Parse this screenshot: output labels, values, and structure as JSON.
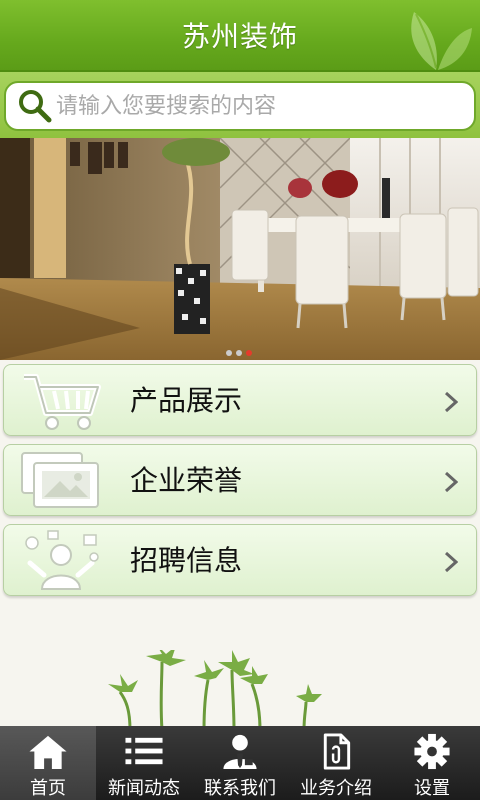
{
  "header": {
    "title": "苏州装饰"
  },
  "search": {
    "placeholder": "请输入您要搜索的内容",
    "value": ""
  },
  "banner": {
    "slide_count": 3,
    "active_slide": 3,
    "active_dot_color": "#e53b2c"
  },
  "menu": [
    {
      "label": "产品展示",
      "icon": "shopping-cart-icon"
    },
    {
      "label": "企业荣誉",
      "icon": "picture-frame-icon"
    },
    {
      "label": "招聘信息",
      "icon": "recruitment-person-icon"
    }
  ],
  "tabbar": [
    {
      "label": "首页",
      "icon": "home-icon",
      "active": true
    },
    {
      "label": "新闻动态",
      "icon": "list-icon",
      "active": false
    },
    {
      "label": "联系我们",
      "icon": "contact-person-icon",
      "active": false
    },
    {
      "label": "业务介绍",
      "icon": "document-icon",
      "active": false
    },
    {
      "label": "设置",
      "icon": "gear-icon",
      "active": false
    }
  ],
  "colors": {
    "brand_green": "#66a91d",
    "menu_bg": "#dff1cf",
    "tabbar_bg": "#1c1c1c"
  }
}
